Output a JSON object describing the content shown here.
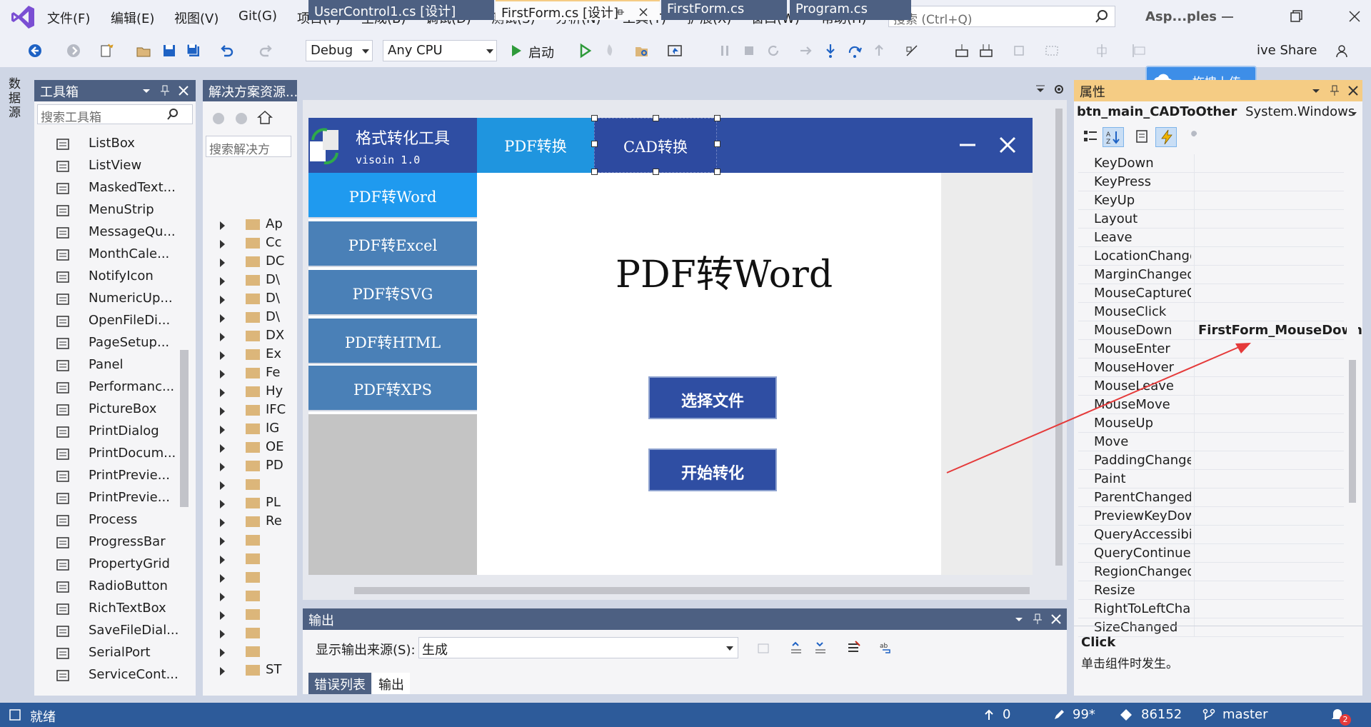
{
  "menubar": {
    "items": [
      "文件(F)",
      "编辑(E)",
      "视图(V)",
      "Git(G)",
      "项目(P)",
      "生成(B)",
      "调试(D)",
      "测试(S)",
      "分析(N)",
      "工具(T)",
      "扩展(X)",
      "窗口(W)",
      "帮助(H)"
    ],
    "search_placeholder": "搜索 (Ctrl+Q)",
    "app_name": "Asp...ples"
  },
  "toolbar": {
    "config": "Debug",
    "platform": "Any CPU",
    "start_label": "启动",
    "live_share": "ive Share",
    "upload_badge": "拖拽上传"
  },
  "left_strip": {
    "label": "数据源"
  },
  "toolbox": {
    "title": "工具箱",
    "search_placeholder": "搜索工具箱",
    "items": [
      {
        "label": "ListBox",
        "icon": "listbox-icon"
      },
      {
        "label": "ListView",
        "icon": "listview-icon"
      },
      {
        "label": "MaskedText...",
        "icon": "maskedtextbox-icon"
      },
      {
        "label": "MenuStrip",
        "icon": "menustrip-icon"
      },
      {
        "label": "MessageQu...",
        "icon": "messagequeue-icon"
      },
      {
        "label": "MonthCale...",
        "icon": "monthcalendar-icon"
      },
      {
        "label": "NotifyIcon",
        "icon": "notifyicon-icon"
      },
      {
        "label": "NumericUp...",
        "icon": "numericupdown-icon"
      },
      {
        "label": "OpenFileDi...",
        "icon": "openfiledialog-icon"
      },
      {
        "label": "PageSetup...",
        "icon": "pagesetup-icon"
      },
      {
        "label": "Panel",
        "icon": "panel-icon"
      },
      {
        "label": "Performanc...",
        "icon": "performancecounter-icon"
      },
      {
        "label": "PictureBox",
        "icon": "picturebox-icon"
      },
      {
        "label": "PrintDialog",
        "icon": "printdialog-icon"
      },
      {
        "label": "PrintDocum...",
        "icon": "printdocument-icon"
      },
      {
        "label": "PrintPrevie...",
        "icon": "printpreview-icon"
      },
      {
        "label": "PrintPrevie...",
        "icon": "printpreviewdialog-icon"
      },
      {
        "label": "Process",
        "icon": "process-icon"
      },
      {
        "label": "ProgressBar",
        "icon": "progressbar-icon"
      },
      {
        "label": "PropertyGrid",
        "icon": "propertygrid-icon"
      },
      {
        "label": "RadioButton",
        "icon": "radiobutton-icon"
      },
      {
        "label": "RichTextBox",
        "icon": "richtextbox-icon"
      },
      {
        "label": "SaveFileDial...",
        "icon": "savefiledialog-icon"
      },
      {
        "label": "SerialPort",
        "icon": "serialport-icon"
      },
      {
        "label": "ServiceCont...",
        "icon": "servicecontroller-icon"
      }
    ]
  },
  "solution": {
    "title": "解决方案资源...",
    "search_placeholder": "搜索解决方",
    "rows": [
      "Ap",
      "Cc",
      "DC",
      "D\\",
      "D\\",
      "D\\",
      "DX",
      "Ex",
      "Fe",
      "Hy",
      "IFC",
      "IG",
      "OE",
      "PD",
      "",
      "PL",
      "Re",
      "",
      "",
      "",
      "",
      "",
      "",
      "",
      "ST"
    ]
  },
  "doc_tabs": [
    {
      "label": "UserControl1.cs [设计]",
      "active": false
    },
    {
      "label": "FirstForm.cs [设计]",
      "active": true
    },
    {
      "label": "FirstForm.cs",
      "active": false
    },
    {
      "label": "Program.cs",
      "active": false
    }
  ],
  "form": {
    "title": "格式转化工具",
    "version": "visoin 1.0",
    "tabs": [
      "PDF转换",
      "CAD转换"
    ],
    "side_buttons": [
      "PDF转Word",
      "PDF转Excel",
      "PDF转SVG",
      "PDF转HTML",
      "PDF转XPS"
    ],
    "heading": "PDF转Word",
    "select_file": "选择文件",
    "start_convert": "开始转化"
  },
  "output": {
    "title": "输出",
    "source_label": "显示输出来源(S):",
    "source_value": "生成",
    "tabs": [
      "错误列表",
      "输出"
    ]
  },
  "properties": {
    "title": "属性",
    "object_name": "btn_main_CADToOther",
    "object_type": "System.Windows",
    "rows": [
      {
        "name": "KeyDown",
        "value": ""
      },
      {
        "name": "KeyPress",
        "value": ""
      },
      {
        "name": "KeyUp",
        "value": ""
      },
      {
        "name": "Layout",
        "value": ""
      },
      {
        "name": "Leave",
        "value": ""
      },
      {
        "name": "LocationChange",
        "value": ""
      },
      {
        "name": "MarginChanged",
        "value": ""
      },
      {
        "name": "MouseCaptureC",
        "value": ""
      },
      {
        "name": "MouseClick",
        "value": ""
      },
      {
        "name": "MouseDown",
        "value": "FirstForm_MouseDown"
      },
      {
        "name": "MouseEnter",
        "value": ""
      },
      {
        "name": "MouseHover",
        "value": ""
      },
      {
        "name": "MouseLeave",
        "value": ""
      },
      {
        "name": "MouseMove",
        "value": ""
      },
      {
        "name": "MouseUp",
        "value": ""
      },
      {
        "name": "Move",
        "value": ""
      },
      {
        "name": "PaddingChange",
        "value": ""
      },
      {
        "name": "Paint",
        "value": ""
      },
      {
        "name": "ParentChanged",
        "value": ""
      },
      {
        "name": "PreviewKeyDow",
        "value": ""
      },
      {
        "name": "QueryAccessibi",
        "value": ""
      },
      {
        "name": "QueryContinuel",
        "value": ""
      },
      {
        "name": "RegionChanged",
        "value": ""
      },
      {
        "name": "Resize",
        "value": ""
      },
      {
        "name": "RightToLeftCha",
        "value": ""
      },
      {
        "name": "SizeChanged",
        "value": ""
      }
    ],
    "desc_title": "Click",
    "desc_text": "单击组件时发生。"
  },
  "status": {
    "ready": "就绪",
    "up_count": "0",
    "edits": "99*",
    "changes": "86152",
    "branch": "master",
    "notifications": "2"
  },
  "colors": {
    "accent": "#2f4ea3",
    "panel_header": "#4d6082",
    "status_bar": "#2d5b9a",
    "active_side": "#1f9aef"
  }
}
